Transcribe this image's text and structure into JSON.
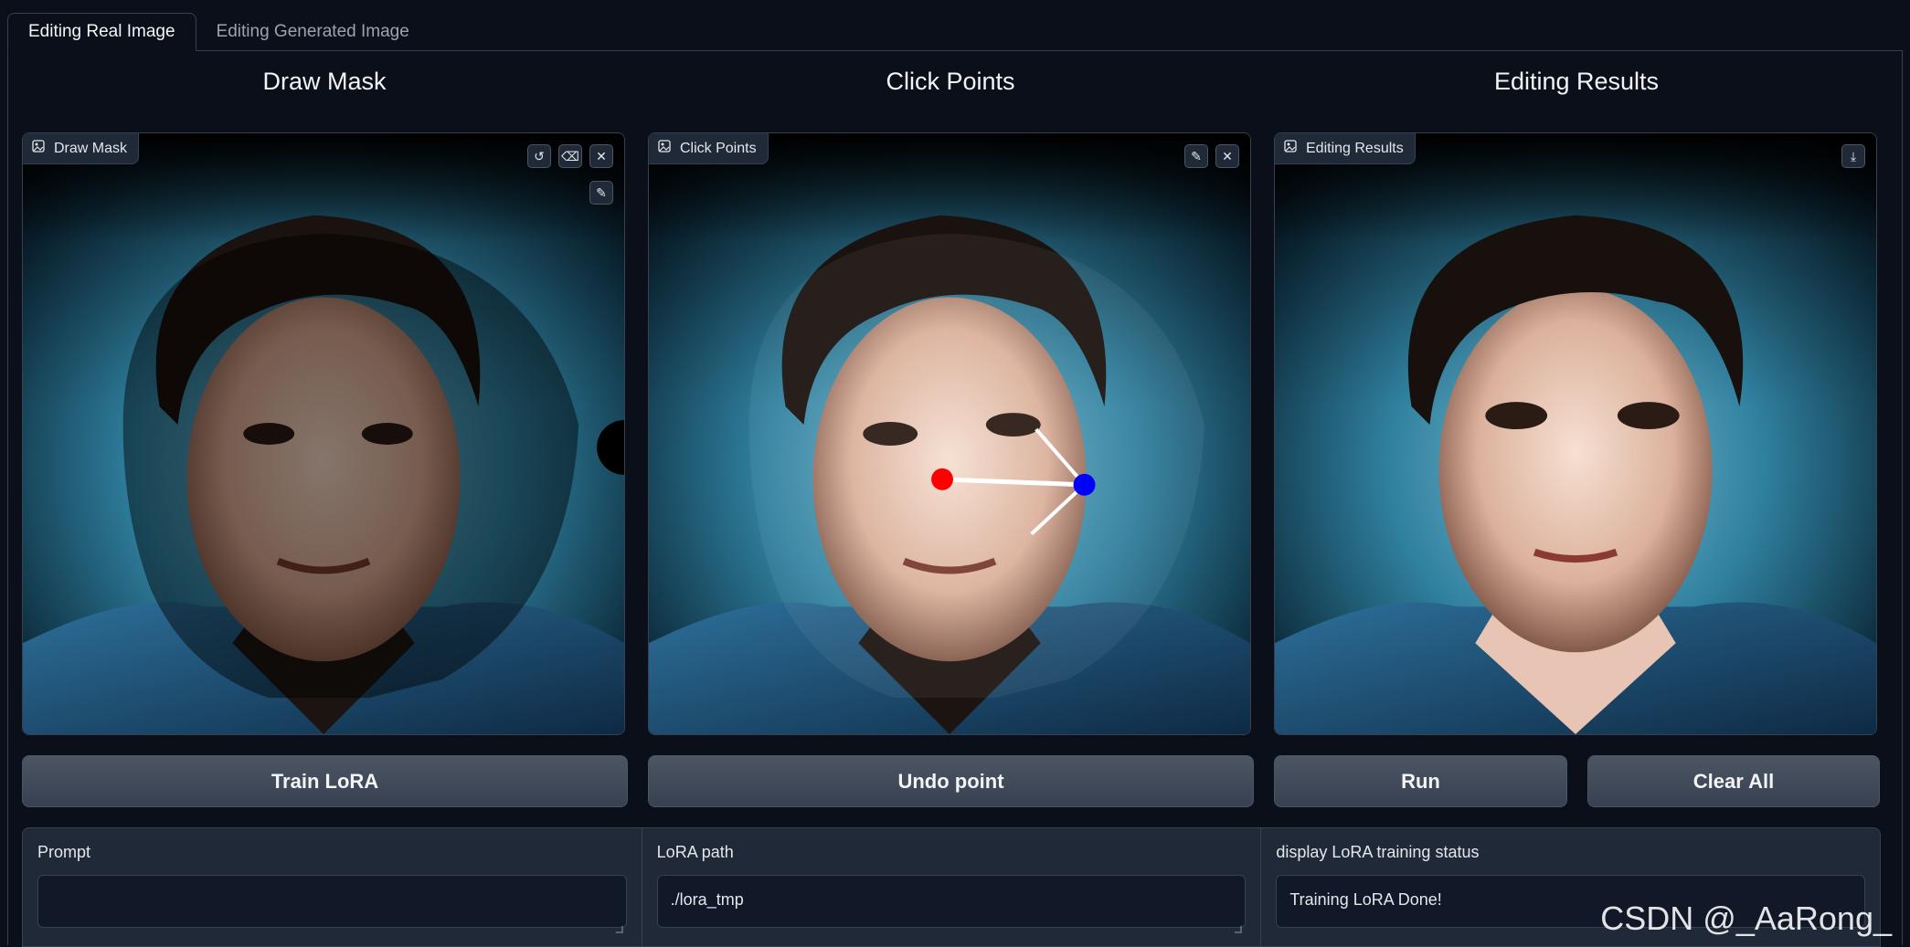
{
  "tabs": [
    {
      "label": "Editing Real Image",
      "active": true
    },
    {
      "label": "Editing Generated Image",
      "active": false
    }
  ],
  "columns": {
    "draw_mask": {
      "title": "Draw Mask",
      "image_label": "Draw Mask",
      "tools": [
        "undo-icon",
        "eraser-icon",
        "close-icon",
        "brush-icon"
      ]
    },
    "click_points": {
      "title": "Click Points",
      "image_label": "Click Points",
      "tools": [
        "edit-icon",
        "close-icon"
      ]
    },
    "editing_results": {
      "title": "Editing Results",
      "image_label": "Editing Results",
      "tools": [
        "download-icon"
      ]
    }
  },
  "buttons": {
    "train_lora": "Train LoRA",
    "undo_point": "Undo point",
    "run": "Run",
    "clear_all": "Clear All"
  },
  "form": {
    "prompt": {
      "label": "Prompt",
      "value": ""
    },
    "lora_path": {
      "label": "LoRA path",
      "value": "./lora_tmp"
    },
    "status": {
      "label": "display LoRA training status",
      "value": "Training LoRA Done!"
    }
  },
  "points": {
    "handle_color": "#ff0000",
    "target_color": "#0000ff"
  },
  "watermark": "CSDN @_AaRong_"
}
